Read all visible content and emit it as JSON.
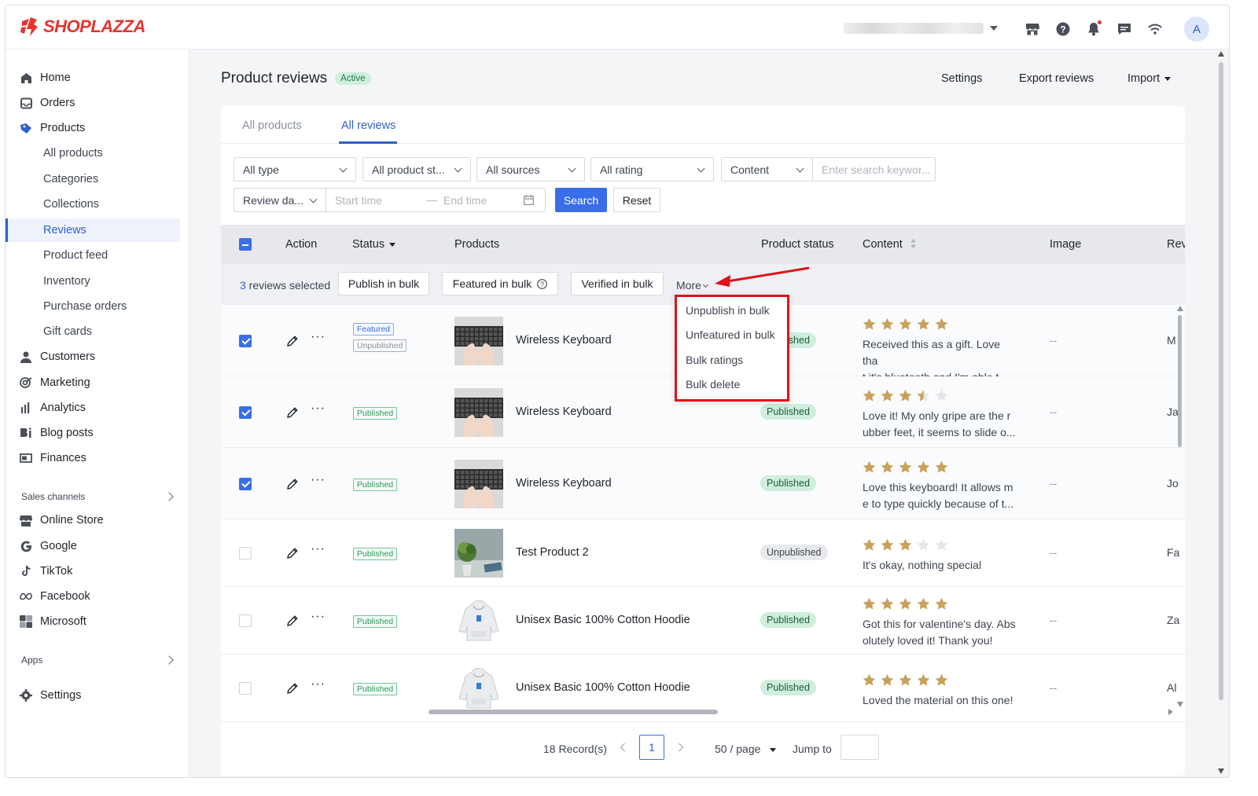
{
  "brand": {
    "name": "SHOPLAZZA",
    "color": "#e6342c"
  },
  "topbar": {
    "icons": [
      "store-icon",
      "help-icon",
      "bell-icon",
      "chat-icon",
      "wifi-icon"
    ],
    "avatar_letter": "A"
  },
  "sidebar": {
    "items": [
      {
        "label": "Home",
        "icon": "home-icon"
      },
      {
        "label": "Orders",
        "icon": "orders-icon"
      },
      {
        "label": "Products",
        "icon": "tag-icon"
      },
      {
        "label": "All products"
      },
      {
        "label": "Categories"
      },
      {
        "label": "Collections"
      },
      {
        "label": "Reviews",
        "active": true
      },
      {
        "label": "Product feed"
      },
      {
        "label": "Inventory"
      },
      {
        "label": "Purchase orders"
      },
      {
        "label": "Gift cards"
      },
      {
        "label": "Customers",
        "icon": "user-icon"
      },
      {
        "label": "Marketing",
        "icon": "target-icon"
      },
      {
        "label": "Analytics",
        "icon": "chart-icon"
      },
      {
        "label": "Blog posts",
        "icon": "blog-icon"
      },
      {
        "label": "Finances",
        "icon": "finance-icon"
      }
    ],
    "sales_channels_label": "Sales channels",
    "channels": [
      {
        "label": "Online Store",
        "icon": "store-icon"
      },
      {
        "label": "Google",
        "icon": "google-icon"
      },
      {
        "label": "TikTok",
        "icon": "tiktok-icon"
      },
      {
        "label": "Facebook",
        "icon": "meta-icon"
      },
      {
        "label": "Microsoft",
        "icon": "microsoft-icon"
      }
    ],
    "apps_label": "Apps",
    "settings_label": "Settings"
  },
  "page": {
    "title": "Product reviews",
    "status_badge": "Active",
    "actions": {
      "settings": "Settings",
      "export": "Export reviews",
      "import": "Import"
    }
  },
  "tabs": [
    {
      "label": "All products"
    },
    {
      "label": "All reviews",
      "active": true
    }
  ],
  "filters": {
    "type": "All type",
    "product_status": "All product st...",
    "sources": "All sources",
    "rating": "All rating",
    "content_field": "Content",
    "search_placeholder": "Enter search keywor...",
    "date_field": "Review da...",
    "start_placeholder": "Start time",
    "end_placeholder": "End time",
    "search_button": "Search",
    "reset_button": "Reset"
  },
  "table": {
    "columns": {
      "action": "Action",
      "status": "Status",
      "products": "Products",
      "product_status": "Product status",
      "content": "Content",
      "image": "Image",
      "reviewer": "Rev"
    },
    "bulk": {
      "count": "3",
      "selected_text": " reviews selected",
      "publish": "Publish in bulk",
      "featured": "Featured in bulk",
      "verified": "Verified in bulk",
      "more": "More"
    },
    "more_menu": [
      "Unpublish in bulk",
      "Unfeatured in bulk",
      "Bulk ratings",
      "Bulk delete"
    ],
    "rows": [
      {
        "checked": true,
        "tags": [
          "Featured",
          "Unpublished"
        ],
        "product": "Wireless Keyboard",
        "thumb": "keyboard",
        "product_status": "Published",
        "rating": 5,
        "content": [
          "Received this as a gift. Love tha",
          "t it's bluetooth and I'm able t..."
        ],
        "image": "--",
        "reviewer": "M"
      },
      {
        "checked": true,
        "tags": [
          "Published"
        ],
        "product": "Wireless Keyboard",
        "thumb": "keyboard",
        "product_status": "Published",
        "rating": 3.5,
        "content": [
          "Love it! My only gripe are the r",
          "ubber feet, it seems to slide o..."
        ],
        "image": "--",
        "reviewer": "Ja"
      },
      {
        "checked": true,
        "tags": [
          "Published"
        ],
        "product": "Wireless Keyboard",
        "thumb": "keyboard",
        "product_status": "Published",
        "rating": 5,
        "content": [
          "Love this keyboard! It allows m",
          "e to type quickly because of t..."
        ],
        "image": "--",
        "reviewer": "Jo"
      },
      {
        "checked": false,
        "tags": [
          "Published"
        ],
        "product": "Test Product 2",
        "thumb": "plant",
        "product_status": "Unpublished",
        "rating": 3,
        "content": [
          "It's okay, nothing special"
        ],
        "image": "--",
        "reviewer": "Fa"
      },
      {
        "checked": false,
        "tags": [
          "Published"
        ],
        "product": "Unisex Basic 100% Cotton Hoodie",
        "thumb": "hoodie",
        "product_status": "Published",
        "rating": 5,
        "content": [
          "Got this for valentine's day. Abs",
          "olutely loved it! Thank you!"
        ],
        "image": "--",
        "reviewer": "Za"
      },
      {
        "checked": false,
        "tags": [
          "Published"
        ],
        "product": "Unisex Basic 100% Cotton Hoodie",
        "thumb": "hoodie",
        "product_status": "Published",
        "rating": 5,
        "content": [
          "Loved the material on this one!"
        ],
        "image": "--",
        "reviewer": "Al"
      }
    ]
  },
  "pagination": {
    "records": "18 Record(s)",
    "current_page": "1",
    "page_size": "50 / page",
    "jump_label": "Jump to"
  },
  "colors": {
    "primary": "#3a6ee8",
    "star": "#c8a15a",
    "star_empty": "#e4e6ea",
    "annotation": "#e0111a"
  }
}
